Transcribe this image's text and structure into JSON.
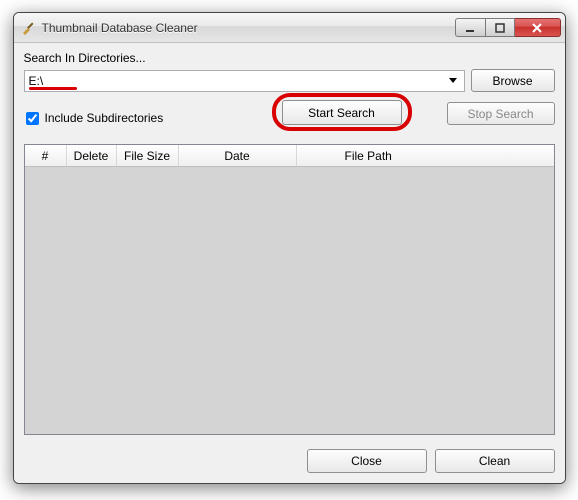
{
  "window": {
    "title": "Thumbnail Database Cleaner"
  },
  "search": {
    "label": "Search In Directories...",
    "path_value": "E:\\",
    "browse_label": "Browse"
  },
  "options": {
    "include_subdirs_label": "Include Subdirectories",
    "include_subdirs_checked": true,
    "start_label": "Start Search",
    "stop_label": "Stop Search"
  },
  "columns": {
    "num": "#",
    "delete": "Delete",
    "size": "File Size",
    "date": "Date",
    "path": "File Path"
  },
  "rows": [],
  "buttons": {
    "close": "Close",
    "clean": "Clean"
  },
  "icons": {
    "app": "broom-icon",
    "dropdown": "chevron-down-icon",
    "minimize": "minimize-icon",
    "maximize": "maximize-icon",
    "close": "close-icon"
  },
  "annotation": {
    "path_underline_color": "#d80000",
    "start_ring_color": "#d80000"
  }
}
